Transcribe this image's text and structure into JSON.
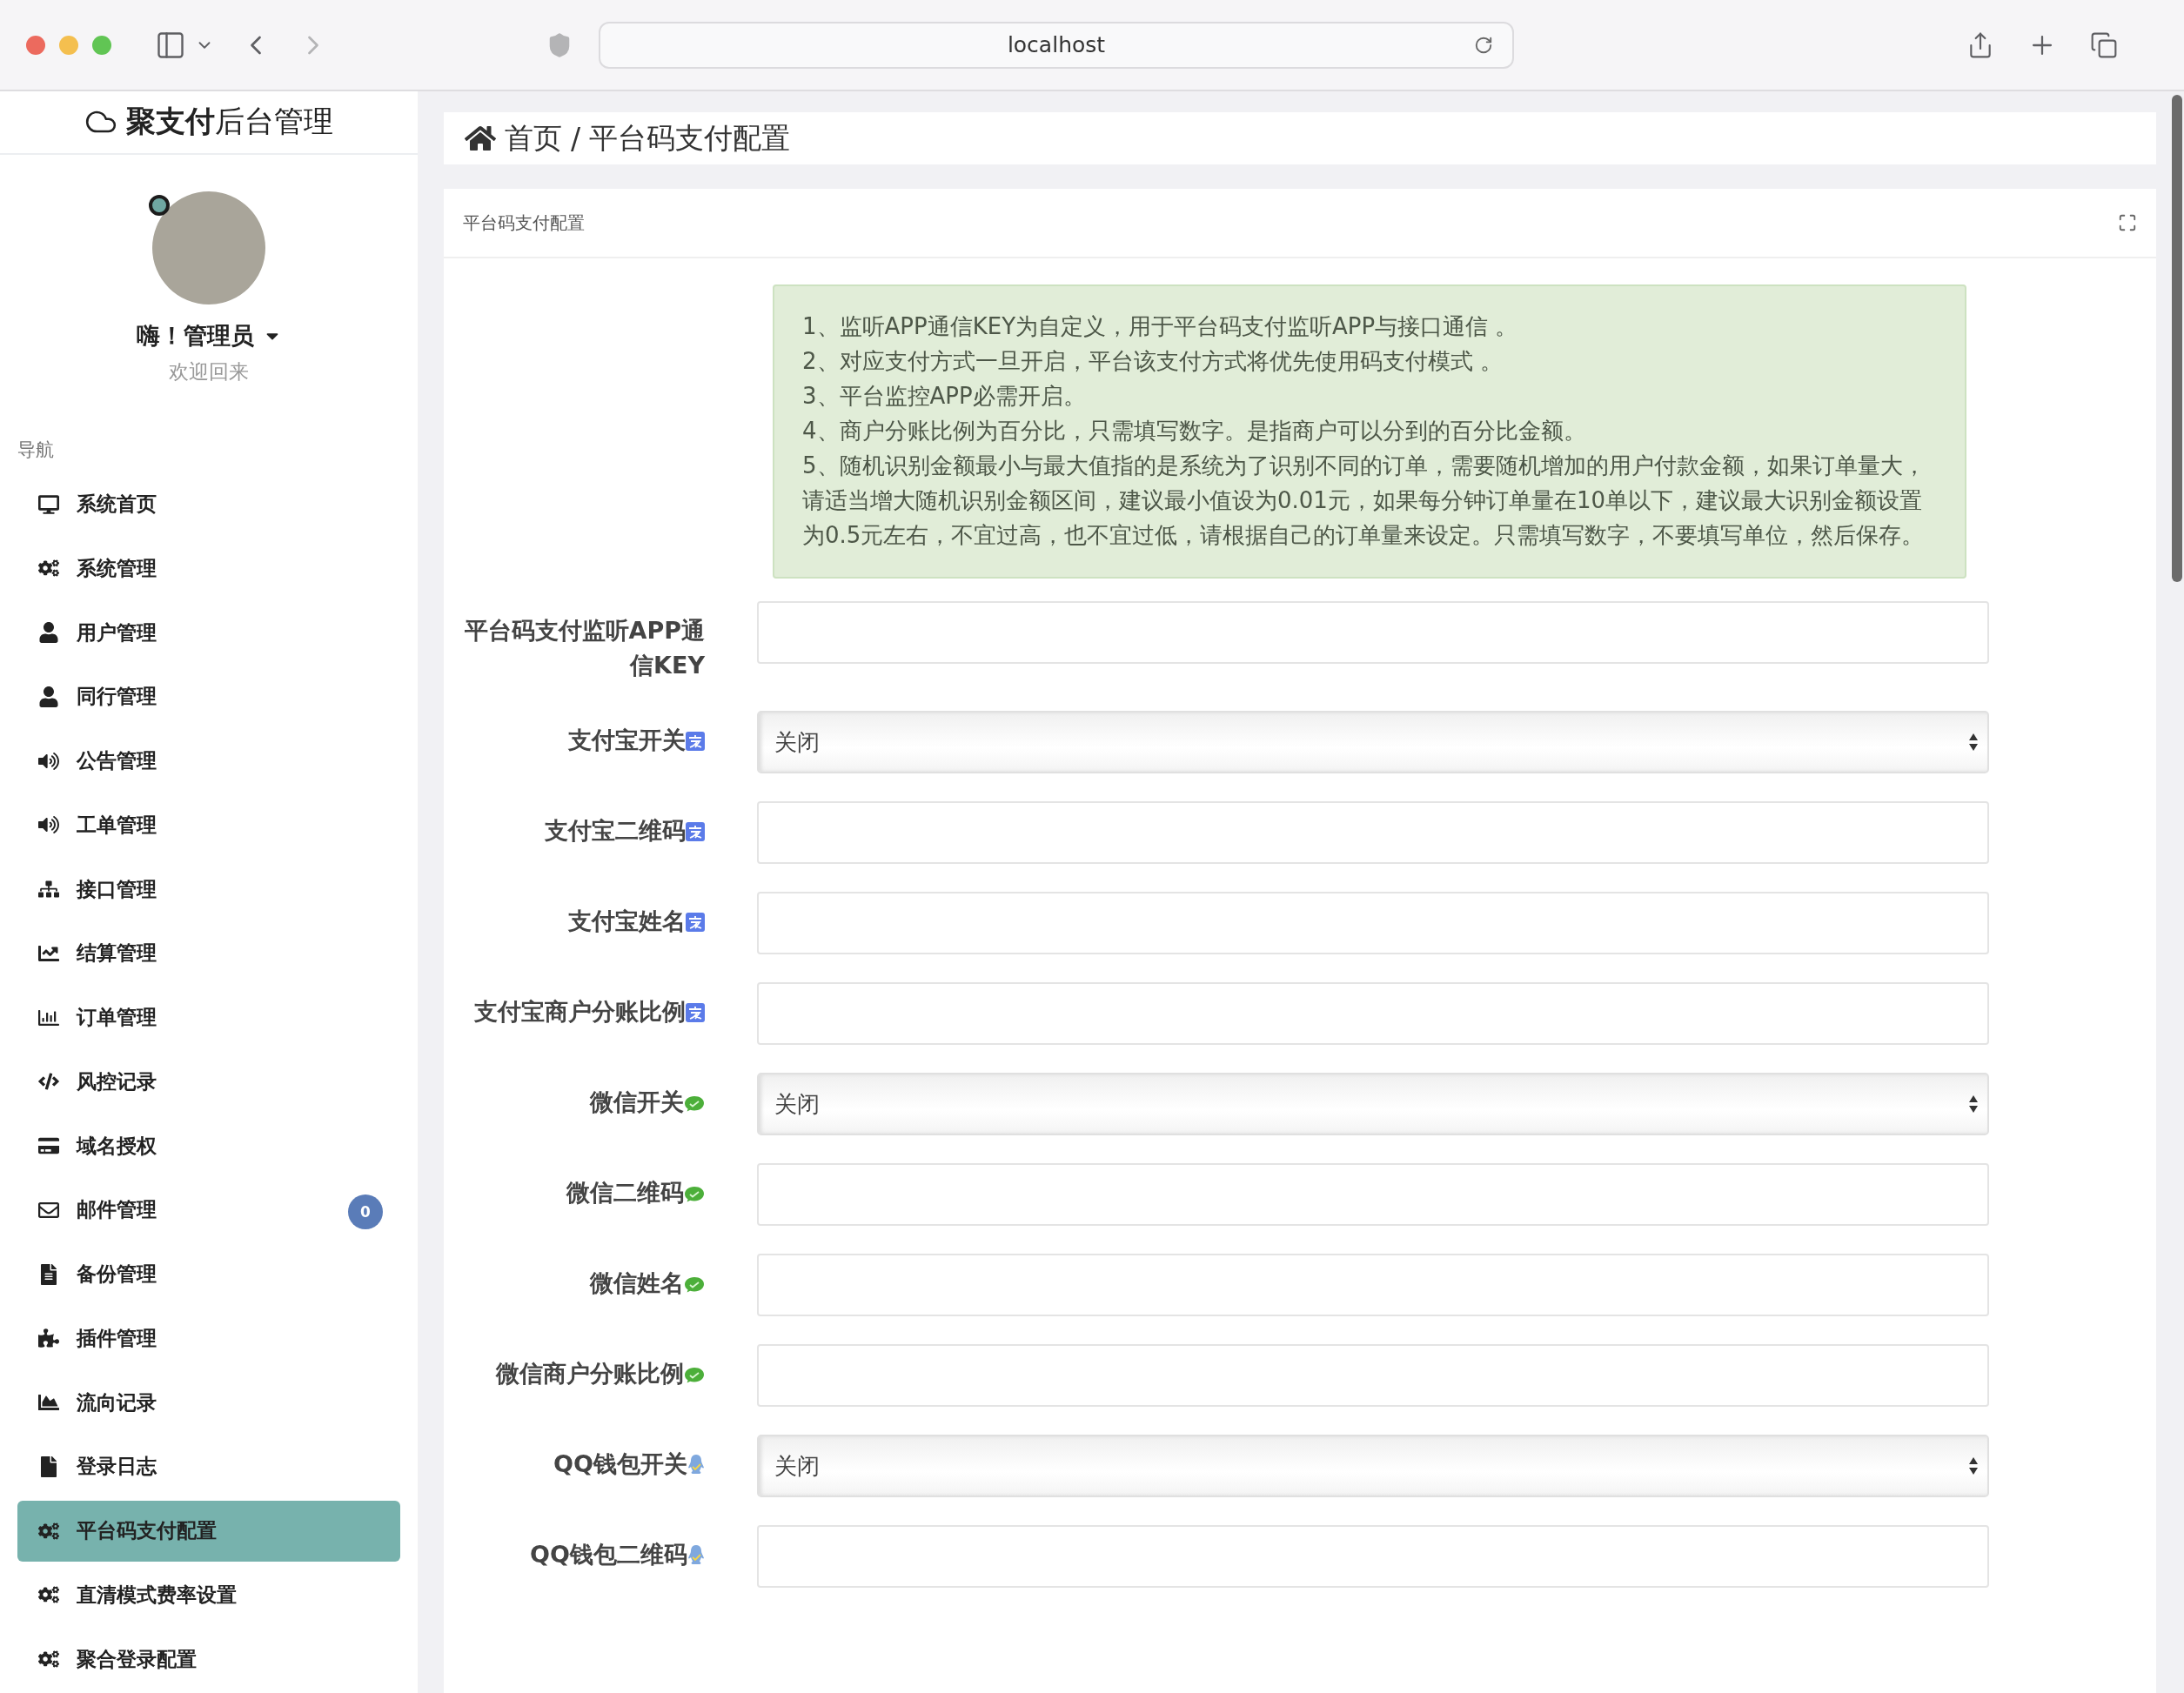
{
  "browser": {
    "url": "localhost"
  },
  "sidebar": {
    "brand_bold": "聚支付",
    "brand_rest": "后台管理",
    "greeting": "嗨！管理员",
    "subtitle": "欢迎回来",
    "nav_heading": "导航",
    "items": [
      {
        "label": "系统首页",
        "selected": false
      },
      {
        "label": "系统管理",
        "selected": false
      },
      {
        "label": "用户管理",
        "selected": false
      },
      {
        "label": "同行管理",
        "selected": false
      },
      {
        "label": "公告管理",
        "selected": false
      },
      {
        "label": "工单管理",
        "selected": false
      },
      {
        "label": "接口管理",
        "selected": false
      },
      {
        "label": "结算管理",
        "selected": false
      },
      {
        "label": "订单管理",
        "selected": false
      },
      {
        "label": "风控记录",
        "selected": false
      },
      {
        "label": "域名授权",
        "selected": false
      },
      {
        "label": "邮件管理",
        "selected": false,
        "badge": "0"
      },
      {
        "label": "备份管理",
        "selected": false
      },
      {
        "label": "插件管理",
        "selected": false
      },
      {
        "label": "流向记录",
        "selected": false
      },
      {
        "label": "登录日志",
        "selected": false
      },
      {
        "label": "平台码支付配置",
        "selected": true
      },
      {
        "label": "直清模式费率设置",
        "selected": false
      },
      {
        "label": "聚合登录配置",
        "selected": false
      }
    ]
  },
  "breadcrumb": {
    "items": [
      "首页",
      "平台码支付配置"
    ],
    "separator": "/"
  },
  "panel": {
    "title": "平台码支付配置",
    "notice": [
      "1、监听APP通信KEY为自定义，用于平台码支付监听APP与接口通信 。",
      "2、对应支付方式一旦开启，平台该支付方式将优先使用码支付模式 。",
      "3、平台监控APP必需开启。",
      "4、商户分账比例为百分比，只需填写数字。是指商户可以分到的百分比金额。",
      "5、随机识别金额最小与最大值指的是系统为了识别不同的订单，需要随机增加的用户付款金额，如果订单量大，请适当增大随机识别金额区间，建议最小值设为0.01元，如果每分钟订单量在10单以下，建议最大识别金额设置为0.5元左右，不宜过高，也不宜过低，请根据自己的订单量来设定。只需填写数字，不要填写单位，然后保存。"
    ],
    "key_field": {
      "label": "平台码支付监听APP通信KEY",
      "kind": "text"
    },
    "alipay": [
      {
        "label": "支付宝开关",
        "kind": "select",
        "value": "关闭"
      },
      {
        "label": "支付宝二维码",
        "kind": "text"
      },
      {
        "label": "支付宝姓名",
        "kind": "text"
      },
      {
        "label": "支付宝商户分账比例",
        "kind": "text"
      }
    ],
    "wechat": [
      {
        "label": "微信开关",
        "kind": "select",
        "value": "关闭"
      },
      {
        "label": "微信二维码",
        "kind": "text"
      },
      {
        "label": "微信姓名",
        "kind": "text"
      },
      {
        "label": "微信商户分账比例",
        "kind": "text"
      }
    ],
    "qq": [
      {
        "label": "QQ钱包开关",
        "kind": "select",
        "value": "关闭"
      },
      {
        "label": "QQ钱包二维码",
        "kind": "text"
      }
    ]
  }
}
